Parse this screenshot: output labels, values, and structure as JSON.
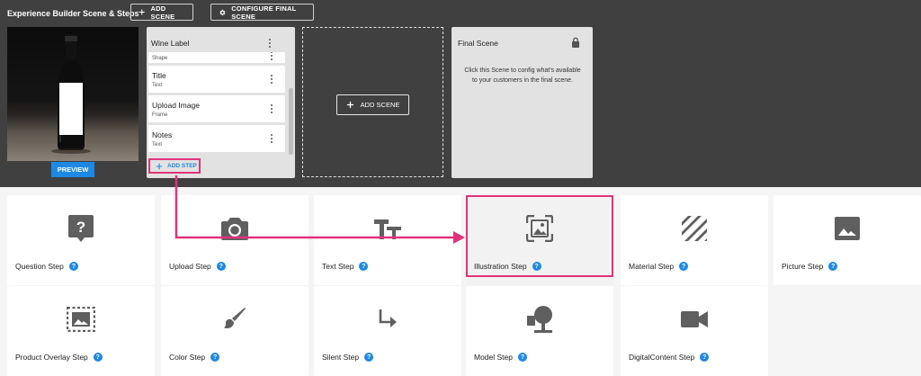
{
  "header": {
    "title": "Experience Builder Scene & Steps",
    "add_scene_label": "ADD SCENE",
    "configure_final_label": "CONFIGURE FINAL SCENE"
  },
  "preview": {
    "button_label": "PREVIEW"
  },
  "scene_card": {
    "title": "Wine Label",
    "steps": [
      {
        "name": "",
        "type": "Shape"
      },
      {
        "name": "Title",
        "type": "Text"
      },
      {
        "name": "Upload Image",
        "type": "Frame"
      },
      {
        "name": "Notes",
        "type": "Text"
      }
    ],
    "add_step_label": "ADD STEP"
  },
  "add_scene_placeholder": {
    "button_label": "ADD SCENE"
  },
  "final_scene": {
    "title": "Final Scene",
    "description": "Click this Scene to config what's available to your customers in the final scene."
  },
  "step_types": [
    {
      "label": "Question Step",
      "icon": "question-icon"
    },
    {
      "label": "Upload Step",
      "icon": "camera-icon"
    },
    {
      "label": "Text Step",
      "icon": "text-tt-icon"
    },
    {
      "label": "Illustration Step",
      "icon": "illustration-icon"
    },
    {
      "label": "Material Step",
      "icon": "material-stripes-icon"
    },
    {
      "label": "Picture Step",
      "icon": "picture-icon"
    },
    {
      "label": "Product Overlay Step",
      "icon": "product-overlay-icon"
    },
    {
      "label": "Color Step",
      "icon": "brush-icon"
    },
    {
      "label": "Silent Step",
      "icon": "silent-arrow-icon"
    },
    {
      "label": "Model Step",
      "icon": "model-icon"
    },
    {
      "label": "DigitalContent Step",
      "icon": "videocam-icon"
    }
  ],
  "help_glyph": "?",
  "colors": {
    "accent_blue": "#1e88e5",
    "highlight_pink": "#e0337a",
    "header_bg": "#404040",
    "icon_gray": "#5f5f5f"
  }
}
